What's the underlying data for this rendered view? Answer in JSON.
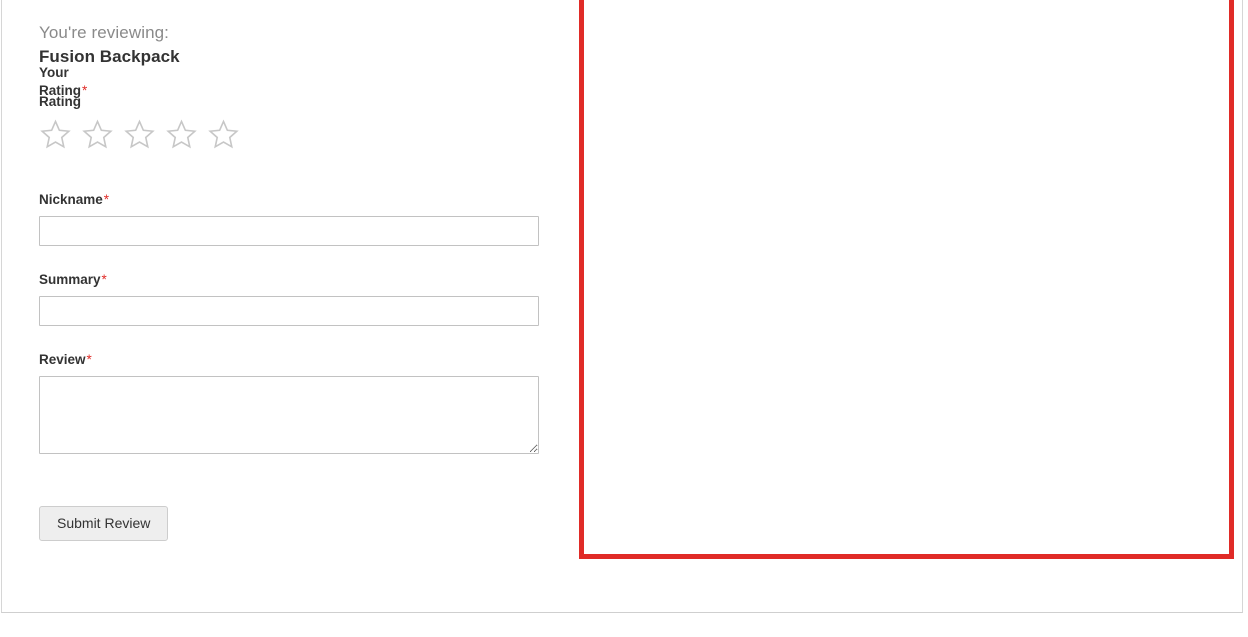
{
  "form": {
    "reviewing_label": "You're reviewing:",
    "product_name": "Fusion Backpack",
    "rating": {
      "legend_label": "Your Rating",
      "legend_required": "*",
      "sub_label": "Rating",
      "stars_total": 5,
      "stars_selected": 0,
      "star_icon": "star-outline-icon",
      "star_color": "#c7c7c7"
    },
    "nickname": {
      "label": "Nickname",
      "required": "*",
      "value": "",
      "placeholder": ""
    },
    "summary": {
      "label": "Summary",
      "required": "*",
      "value": "",
      "placeholder": ""
    },
    "review": {
      "label": "Review",
      "required": "*",
      "value": "",
      "placeholder": ""
    },
    "submit_label": "Submit Review"
  },
  "annotation": {
    "highlight_color": "#e02b27",
    "border_width_px": 5
  },
  "colors": {
    "required_asterisk": "#e02b27",
    "label_text": "#333333",
    "muted_text": "#8a8a8a",
    "input_border": "#c2c2c2",
    "button_bg": "#eeeeee",
    "container_border": "#d6d6d6"
  }
}
